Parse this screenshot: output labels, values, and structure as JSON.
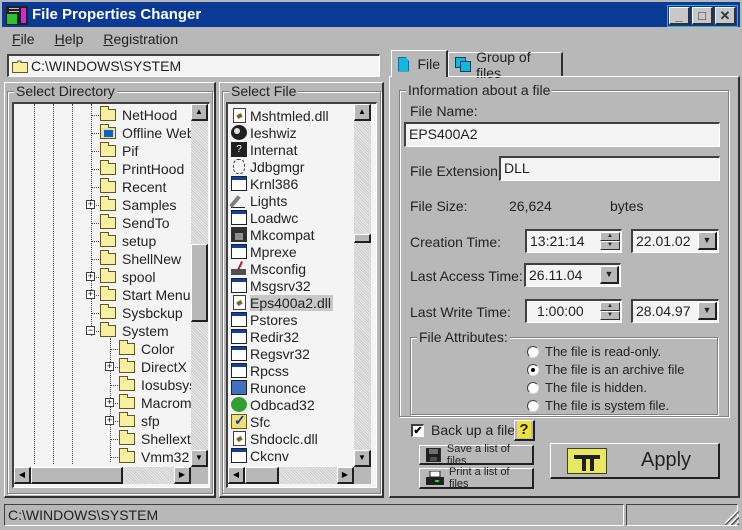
{
  "window": {
    "title": "File Properties Changer",
    "title_bar_color": "#0a3a94",
    "controls": {
      "minimize": "_",
      "maximize": "□",
      "close": "✕"
    }
  },
  "menu": {
    "items": [
      {
        "label": "File",
        "accel": "F"
      },
      {
        "label": "Help",
        "accel": "H"
      },
      {
        "label": "Registration",
        "accel": "R"
      }
    ]
  },
  "path_box": {
    "value": "C:\\WINDOWS\\SYSTEM",
    "icon": "folder-icon"
  },
  "select_directory": {
    "label": "Select Directory",
    "items": [
      {
        "name": "NetHood",
        "level": 0,
        "expand": "",
        "icon": "folder"
      },
      {
        "name": "Offline Web F",
        "level": 0,
        "expand": "",
        "icon": "offline-folder"
      },
      {
        "name": "Pif",
        "level": 0,
        "expand": "",
        "icon": "folder"
      },
      {
        "name": "PrintHood",
        "level": 0,
        "expand": "",
        "icon": "folder"
      },
      {
        "name": "Recent",
        "level": 0,
        "expand": "",
        "icon": "folder"
      },
      {
        "name": "Samples",
        "level": 0,
        "expand": "+",
        "icon": "folder"
      },
      {
        "name": "SendTo",
        "level": 0,
        "expand": "",
        "icon": "folder"
      },
      {
        "name": "setup",
        "level": 0,
        "expand": "",
        "icon": "folder"
      },
      {
        "name": "ShellNew",
        "level": 0,
        "expand": "",
        "icon": "folder"
      },
      {
        "name": "spool",
        "level": 0,
        "expand": "+",
        "icon": "folder"
      },
      {
        "name": "Start Menu",
        "level": 0,
        "expand": "+",
        "icon": "folder"
      },
      {
        "name": "Sysbckup",
        "level": 0,
        "expand": "",
        "icon": "folder"
      },
      {
        "name": "System",
        "level": 0,
        "expand": "-",
        "icon": "open-folder"
      },
      {
        "name": "Color",
        "level": 1,
        "expand": "",
        "icon": "folder"
      },
      {
        "name": "DirectX",
        "level": 1,
        "expand": "+",
        "icon": "folder"
      },
      {
        "name": "Iosubsys",
        "level": 1,
        "expand": "",
        "icon": "folder"
      },
      {
        "name": "Macromed",
        "level": 1,
        "expand": "+",
        "icon": "folder"
      },
      {
        "name": "sfp",
        "level": 1,
        "expand": "+",
        "icon": "folder"
      },
      {
        "name": "Shellext",
        "level": 1,
        "expand": "",
        "icon": "folder"
      },
      {
        "name": "Vmm32",
        "level": 1,
        "expand": "",
        "icon": "folder"
      }
    ]
  },
  "select_file": {
    "label": "Select File",
    "selected_index": 11,
    "items": [
      {
        "name": "Mshtmled.dll",
        "icon": "dll"
      },
      {
        "name": "Ieshwiz",
        "icon": "globe"
      },
      {
        "name": "Internat",
        "icon": "help"
      },
      {
        "name": "Jdbgmgr",
        "icon": "bug"
      },
      {
        "name": "Krnl386",
        "icon": "app"
      },
      {
        "name": "Lights",
        "icon": "pen"
      },
      {
        "name": "Loadwc",
        "icon": "app"
      },
      {
        "name": "Mkcompat",
        "icon": "tool"
      },
      {
        "name": "Mprexe",
        "icon": "app"
      },
      {
        "name": "Msconfig",
        "icon": "cfg"
      },
      {
        "name": "Msgsrv32",
        "icon": "app"
      },
      {
        "name": "Eps400a2.dll",
        "icon": "dll"
      },
      {
        "name": "Pstores",
        "icon": "app"
      },
      {
        "name": "Redir32",
        "icon": "app"
      },
      {
        "name": "Regsvr32",
        "icon": "app"
      },
      {
        "name": "Rpcss",
        "icon": "app"
      },
      {
        "name": "Runonce",
        "icon": "pc"
      },
      {
        "name": "Odbcad32",
        "icon": "odbc"
      },
      {
        "name": "Sfc",
        "icon": "sfc"
      },
      {
        "name": "Shdoclc.dll",
        "icon": "dll"
      },
      {
        "name": "Ckcnv",
        "icon": "app"
      }
    ]
  },
  "tabs": [
    {
      "label": "File",
      "active": true
    },
    {
      "label": "Group of files",
      "active": false
    }
  ],
  "file_info": {
    "group_label": "Information about a file",
    "file_name_label": "File Name:",
    "file_name": "EPS400A2",
    "extension_label": "File Extension:",
    "extension": "DLL",
    "size_label": "File Size:",
    "size": "26,624",
    "size_unit": "bytes",
    "creation_label": "Creation Time:",
    "creation_time": "13:21:14",
    "creation_date": "22.01.02",
    "access_label": "Last Access Time:",
    "access_date": "26.11.04",
    "write_label": "Last Write Time:",
    "write_time": "1:00:00",
    "write_date": "28.04.97"
  },
  "attributes": {
    "label": "File Attributes:",
    "options": [
      {
        "label": "The file is read-only.",
        "checked": false
      },
      {
        "label": "The file is an archive file",
        "checked": true
      },
      {
        "label": "The file is hidden.",
        "checked": false
      },
      {
        "label": "The file is system file.",
        "checked": false
      }
    ]
  },
  "backup": {
    "label": "Back up a file",
    "checked": true,
    "check_glyph": "✔",
    "help_glyph": "?"
  },
  "buttons": {
    "save_list": "Save a list of files",
    "print_list": "Print a list of files",
    "apply": "Apply"
  },
  "status_bar": {
    "path": "C:\\WINDOWS\\SYSTEM",
    "pane2": ""
  }
}
